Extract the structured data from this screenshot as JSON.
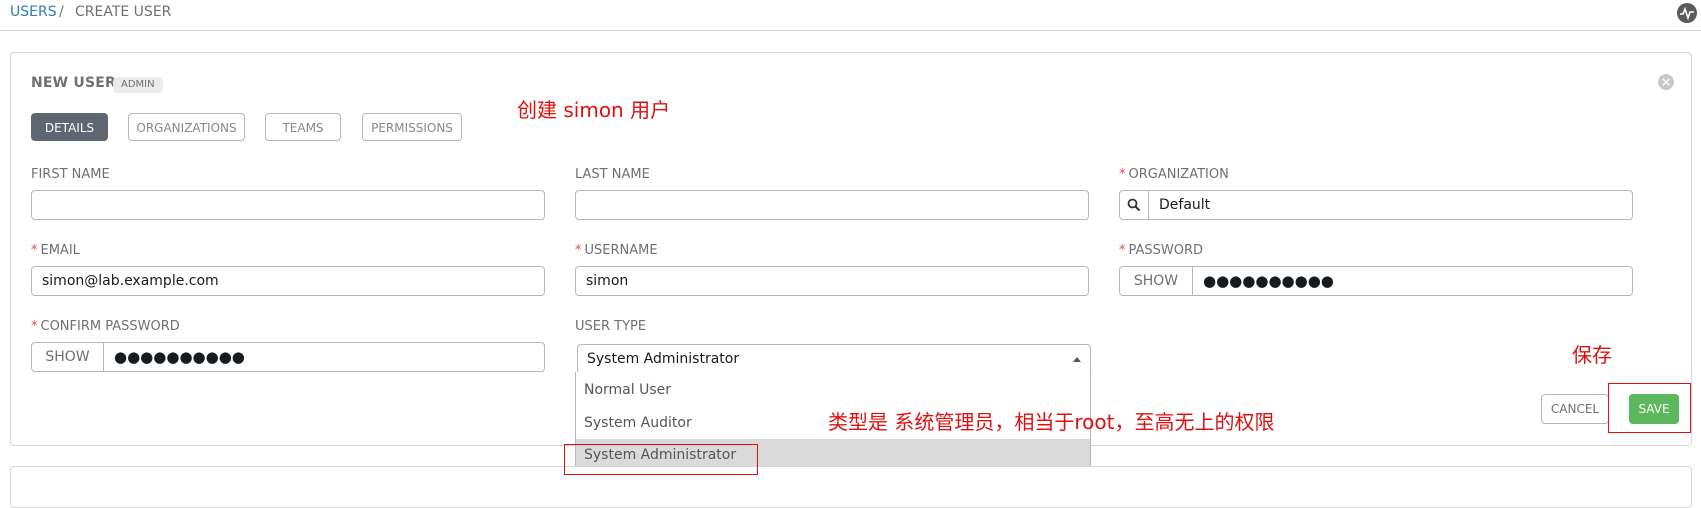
{
  "breadcrumb": {
    "parent": "USERS",
    "separator": "/",
    "current": "CREATE USER"
  },
  "panel": {
    "title": "NEW USER",
    "badge": "ADMIN"
  },
  "tabs": [
    {
      "label": "DETAILS",
      "active": true
    },
    {
      "label": "ORGANIZATIONS",
      "active": false
    },
    {
      "label": "TEAMS",
      "active": false
    },
    {
      "label": "PERMISSIONS",
      "active": false
    }
  ],
  "form": {
    "first_name": {
      "label": "FIRST NAME",
      "value": ""
    },
    "last_name": {
      "label": "LAST NAME",
      "value": ""
    },
    "organization": {
      "label": "ORGANIZATION",
      "required": "*",
      "value": "Default"
    },
    "email": {
      "label": "EMAIL",
      "required": "*",
      "value": "simon@lab.example.com"
    },
    "username": {
      "label": "USERNAME",
      "required": "*",
      "value": "simon"
    },
    "password": {
      "label": "PASSWORD",
      "required": "*",
      "show": "SHOW",
      "value": "●●●●●●●●●●"
    },
    "confirm_password": {
      "label": "CONFIRM PASSWORD",
      "required": "*",
      "show": "SHOW",
      "value": "●●●●●●●●●●"
    },
    "user_type": {
      "label": "USER TYPE",
      "selected": "System Administrator",
      "options": [
        "Normal User",
        "System Auditor",
        "System Administrator"
      ]
    }
  },
  "actions": {
    "cancel": "CANCEL",
    "save": "SAVE"
  },
  "annotations": {
    "create": "创建 simon 用户",
    "save": "保存",
    "type": "类型是 系统管理员，相当于root，至高无上的权限"
  },
  "colors": {
    "accent_link": "#337ab7",
    "save_green": "#5cb85c",
    "annotation_red": "#e01010",
    "active_tab": "#5f6670"
  }
}
